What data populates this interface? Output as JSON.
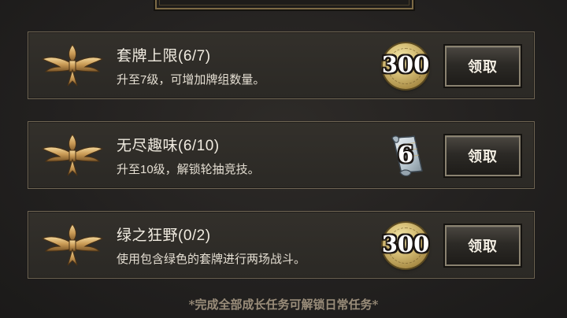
{
  "quests": [
    {
      "title": "套牌上限(6/7)",
      "description": "升至7级，可增加牌组数量。",
      "reward": {
        "type": "gold",
        "icon": "gold-coin-icon",
        "amount": "300"
      },
      "button_label": "领取"
    },
    {
      "title": "无尽趣味(6/10)",
      "description": "升至10级，解锁轮抽竞技。",
      "reward": {
        "type": "ticket",
        "icon": "arena-ticket-icon",
        "amount": "6"
      },
      "button_label": "领取"
    },
    {
      "title": "绿之狂野(0/2)",
      "description": "使用包含绿色的套牌进行两场战斗。",
      "reward": {
        "type": "gold",
        "icon": "gold-coin-icon",
        "amount": "300"
      },
      "button_label": "领取"
    }
  ],
  "footer_note": "*完成全部成长任务可解锁日常任务*",
  "colors": {
    "background": "#232120",
    "card_border": "#6f6553",
    "gold": "#d9c27a",
    "footer_text": "#9a8d7a"
  }
}
